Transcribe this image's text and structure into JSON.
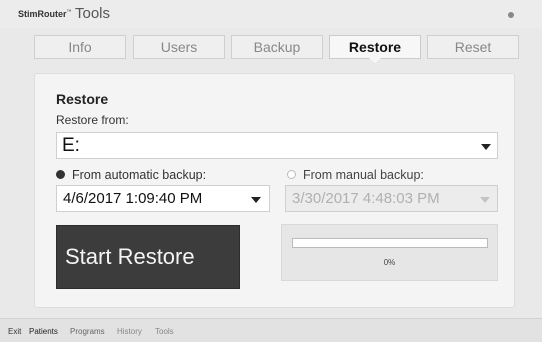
{
  "window": {
    "brand": "StimRouter",
    "brand_mark": "™",
    "title": "Tools"
  },
  "tabs": [
    {
      "label": "Info",
      "active": false
    },
    {
      "label": "Users",
      "active": false
    },
    {
      "label": "Backup",
      "active": false
    },
    {
      "label": "Restore",
      "active": true
    },
    {
      "label": "Reset",
      "active": false
    }
  ],
  "restore": {
    "section_title": "Restore",
    "restore_from_label": "Restore from:",
    "drive_value": "E:",
    "automatic": {
      "label": "From automatic backup:",
      "selected": true,
      "value": "4/6/2017 1:09:40 PM"
    },
    "manual": {
      "label": "From manual backup:",
      "selected": false,
      "value": "3/30/2017 4:48:03 PM",
      "disabled": true
    },
    "start_label": "Start Restore",
    "progress_percent": 0,
    "progress_text": "0%"
  },
  "bottom_nav": [
    {
      "label": "Exit"
    },
    {
      "label": "Patients"
    },
    {
      "label": "Programs"
    },
    {
      "label": "History"
    },
    {
      "label": "Tools"
    }
  ],
  "colors": {
    "button_bg": "#3c3c3c",
    "panel_bg": "#f4f4f4",
    "disabled_text": "#b0b0b0"
  }
}
